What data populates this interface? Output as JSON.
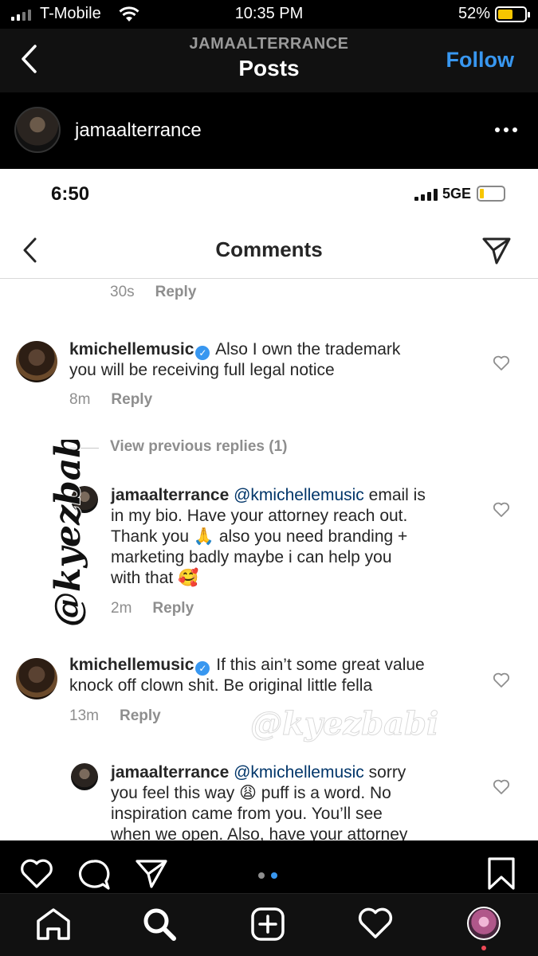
{
  "outer_status": {
    "carrier": "T-Mobile",
    "time": "10:35 PM",
    "battery": "52%",
    "battery_level": 0.52,
    "battery_color": "#f7c600"
  },
  "header": {
    "username": "JAMAALTERRANCE",
    "title": "Posts",
    "follow": "Follow",
    "follow_color": "#3897f0"
  },
  "post": {
    "username": "jamaalterrance",
    "more_icon": "more-horizontal-icon"
  },
  "inner": {
    "time": "6:50",
    "network": "5GE",
    "title": "Comments",
    "prev_meta": {
      "time": "30s",
      "reply": "Reply"
    },
    "comments": [
      {
        "user": "kmichellemusic",
        "text_line1": "Also I own the trademark",
        "text_line2": "you will be receiving full legal notice",
        "time": "8m",
        "reply": "Reply"
      },
      {
        "view_previous": "View previous replies (1)"
      },
      {
        "user": "jamaalterrance",
        "mention": "@kmichellemusic",
        "text_line1": "email is",
        "text_line2": "in my bio. Have your attorney reach out.",
        "text_line3": "Thank you 🙏 also you need branding +",
        "text_line4": "marketing badly maybe i can help you",
        "text_line5": "with that 🥰",
        "time": "2m",
        "reply": "Reply"
      },
      {
        "user": "kmichellemusic",
        "text_line1": "If this ain’t some great value",
        "text_line2": "knock off clown shit. Be original little fella",
        "time": "13m",
        "reply": "Reply"
      },
      {
        "user": "jamaalterrance",
        "mention": "@kmichellemusic",
        "text_line1": "sorry",
        "text_line2": "you feel this way 😩 puff is a word. No",
        "text_line3": "inspiration came from you. You’ll see",
        "text_line4": "when we open. Also, have your attorney"
      }
    ],
    "watermark_vertical": "@kyezbabi",
    "watermark_horizontal": "@kyezbabi"
  },
  "actions": {
    "like_icon": "heart-icon",
    "comment_icon": "comment-icon",
    "share_icon": "send-icon",
    "save_icon": "bookmark-icon",
    "carousel_active": 2,
    "carousel_total": 2
  },
  "nav": {
    "items": [
      "home-icon",
      "search-icon",
      "add-post-icon",
      "activity-heart-icon",
      "profile-avatar"
    ]
  }
}
